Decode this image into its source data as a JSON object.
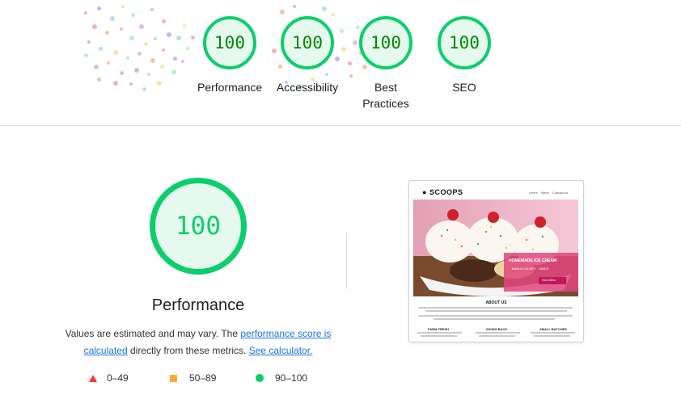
{
  "summary": {
    "gauges": [
      {
        "score": "100",
        "label": "Performance"
      },
      {
        "score": "100",
        "label": "Accessibility"
      },
      {
        "score": "100",
        "label": "Best Practices"
      },
      {
        "score": "100",
        "label": "SEO"
      }
    ]
  },
  "performance": {
    "score": "100",
    "title": "Performance",
    "desc_prefix": "Values are estimated and may vary. The ",
    "link_score": "performance score is calculated",
    "desc_middle": " directly from these metrics. ",
    "link_calc": "See calculator."
  },
  "legend": [
    {
      "range": "0–49",
      "color": "#ff3333"
    },
    {
      "range": "50–89",
      "color": "#ffaa33"
    },
    {
      "range": "90–100",
      "color": "#0cce6b"
    }
  ],
  "screenshot": {
    "logo": "SCOOPS",
    "nav": [
      "Home",
      "Menu",
      "Contact us"
    ],
    "hero_title": "HOMEMADE ICE CREAM",
    "hero_subtitle": "BAHIA COUNTY · SINCE",
    "hero_button": "View Menu",
    "about_heading": "ABOUT US",
    "features": [
      "FARM FRESH",
      "GIVING BACK",
      "SMALL BATCHES"
    ]
  },
  "colors": {
    "pass": "#0cce6b",
    "pass_bg": "#e6f9ee",
    "score_text": "#008800",
    "link": "#1a73e8"
  }
}
